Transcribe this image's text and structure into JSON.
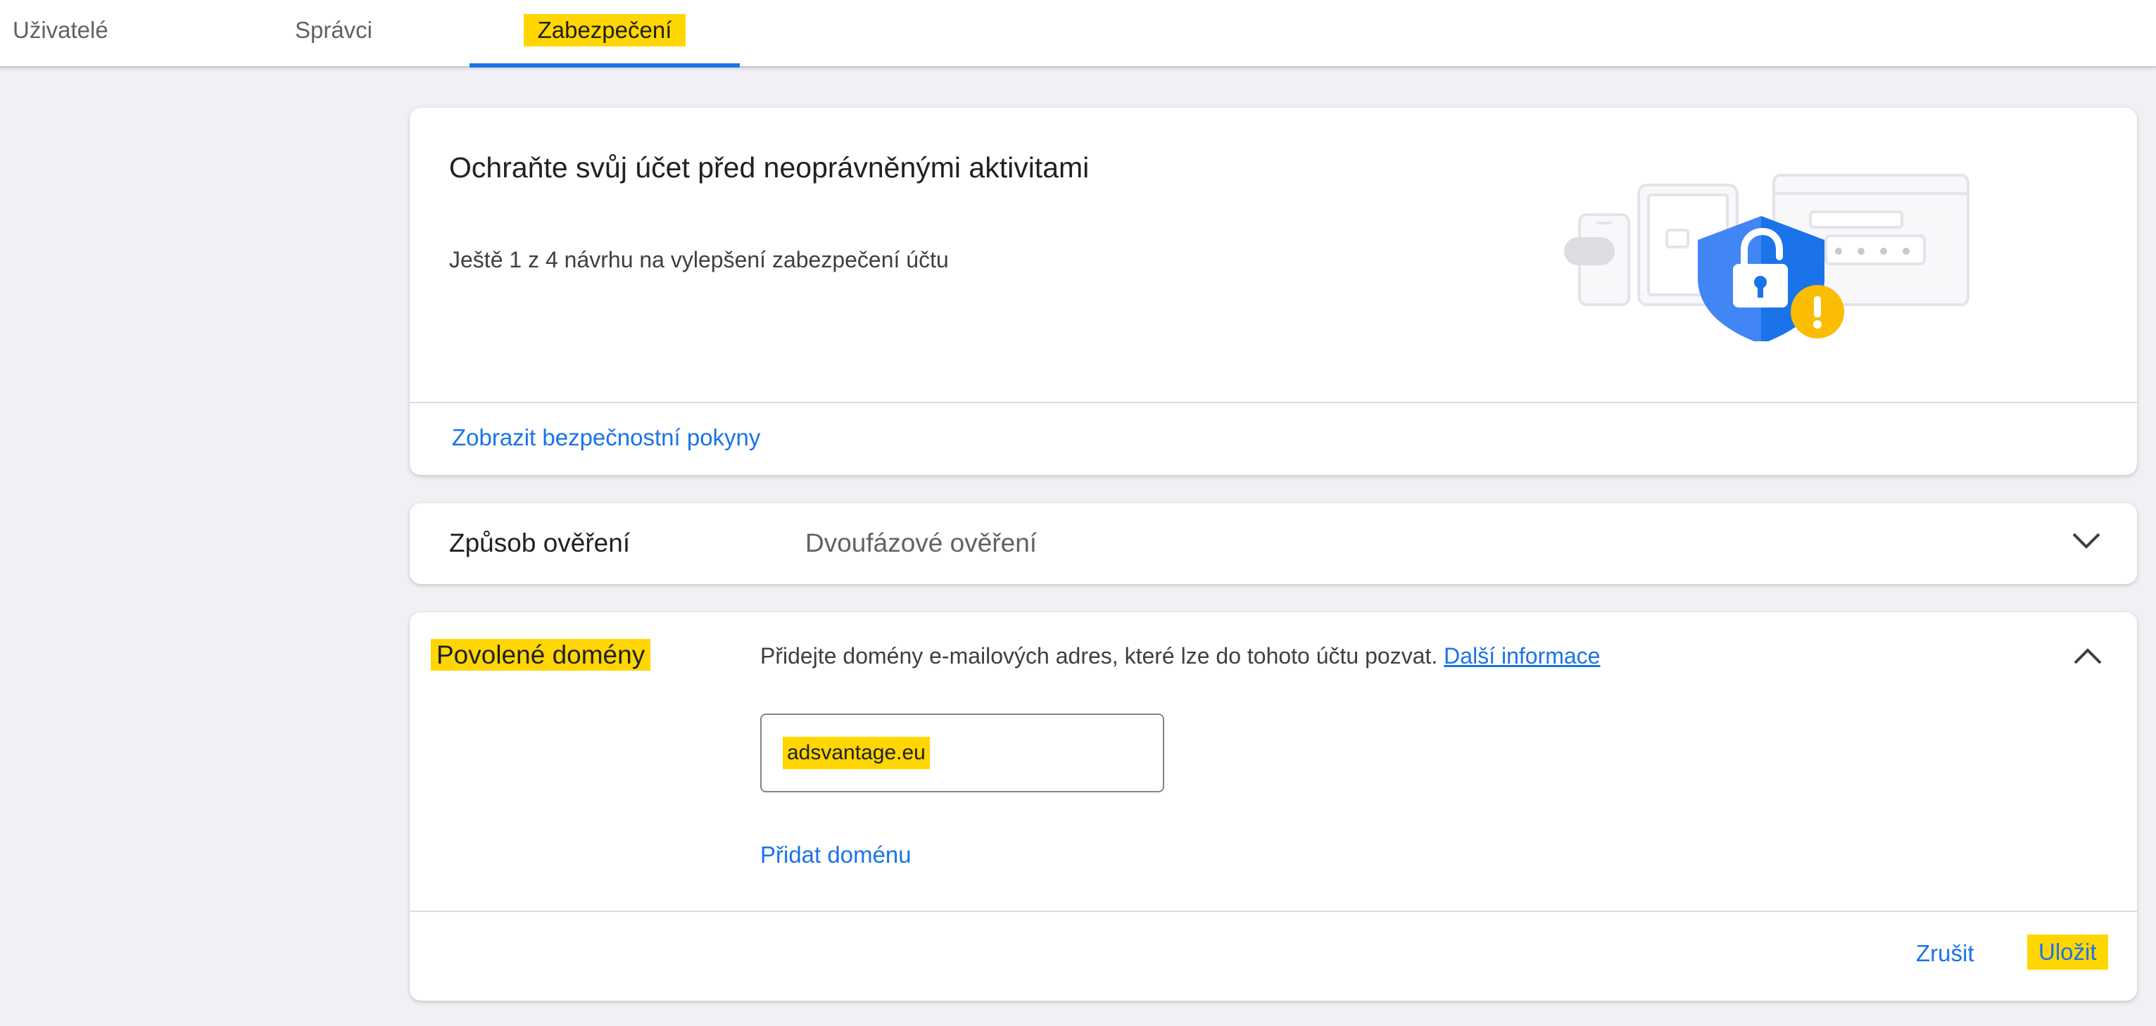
{
  "tabs": [
    {
      "label": "Uživatelé",
      "active": false
    },
    {
      "label": "Správci",
      "active": false
    },
    {
      "label": "Zabezpečení",
      "active": true
    }
  ],
  "security_card": {
    "title": "Ochraňte svůj účet před neoprávněnými aktivitami",
    "subtitle": "Ještě 1 z 4 návrhu na vylepšení zabezpečení účtu",
    "link_label": "Zobrazit bezpečnostní pokyny"
  },
  "auth_method": {
    "label": "Způsob ověření",
    "value": "Dvoufázové ověření",
    "expand_icon": "chevron-down-icon"
  },
  "allowed_domains": {
    "label": "Povolené domény",
    "description": "Přidejte domény e-mailových adres, které lze do tohoto účtu pozvat.",
    "more_info_label": "Další informace",
    "domain_value": "adsvantage.eu",
    "add_domain_label": "Přidat doménu",
    "cancel_label": "Zrušit",
    "save_label": "Uložit",
    "collapse_icon": "chevron-up-icon"
  },
  "colors": {
    "accent": "#1a73e8",
    "highlight": "#ffd600",
    "shield": "#4285f4",
    "warning": "#fbbc04"
  }
}
